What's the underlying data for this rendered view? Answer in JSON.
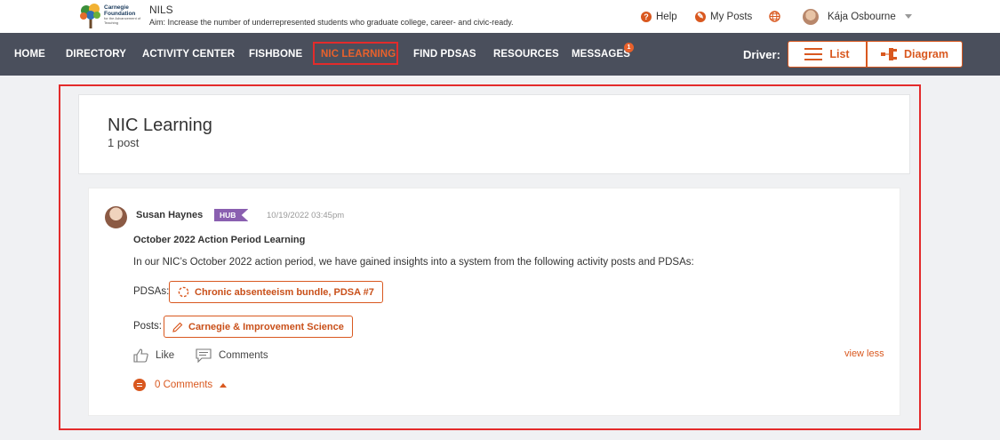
{
  "header": {
    "logo": {
      "line1": "Carnegie",
      "line2": "Foundation",
      "sub": "for the Advancement of Teaching"
    },
    "app_name": "NILS",
    "aim": "Aim:  Increase the number of underrepresented students who graduate college, career- and civic-ready.",
    "help_label": "Help",
    "my_posts_label": "My Posts",
    "user_name": "Kája Osbourne"
  },
  "nav": {
    "items": [
      "HOME",
      "DIRECTORY",
      "ACTIVITY CENTER",
      "FISHBONE",
      "NIC LEARNING",
      "FIND PDSAS",
      "RESOURCES",
      "MESSAGES"
    ],
    "messages_badge": "1",
    "driver_label": "Driver:",
    "list_label": "List",
    "diagram_label": "Diagram"
  },
  "page": {
    "title": "NIC Learning",
    "subtitle": "1 post"
  },
  "post": {
    "author": "Susan Haynes",
    "badge": "HUB",
    "date": "10/19/2022 03:45pm",
    "title": "October 2022 Action Period Learning",
    "body": "In our NIC’s October 2022 action period, we have gained insights into a system from the following activity posts and PDSAs:",
    "pdsas_label": "PDSAs:",
    "pdsa_link": "Chronic absenteeism bundle, PDSA #7",
    "posts_label": "Posts:",
    "post_link": "Carnegie & Improvement Science",
    "like_label": "Like",
    "comments_label": "Comments",
    "view_less": "view less",
    "comment_count": "0 Comments"
  },
  "colors": {
    "accent": "#d9581f",
    "nav_bg": "#4a4f5c",
    "hub_badge": "#8a5fb0",
    "highlight": "#e32b2b"
  }
}
